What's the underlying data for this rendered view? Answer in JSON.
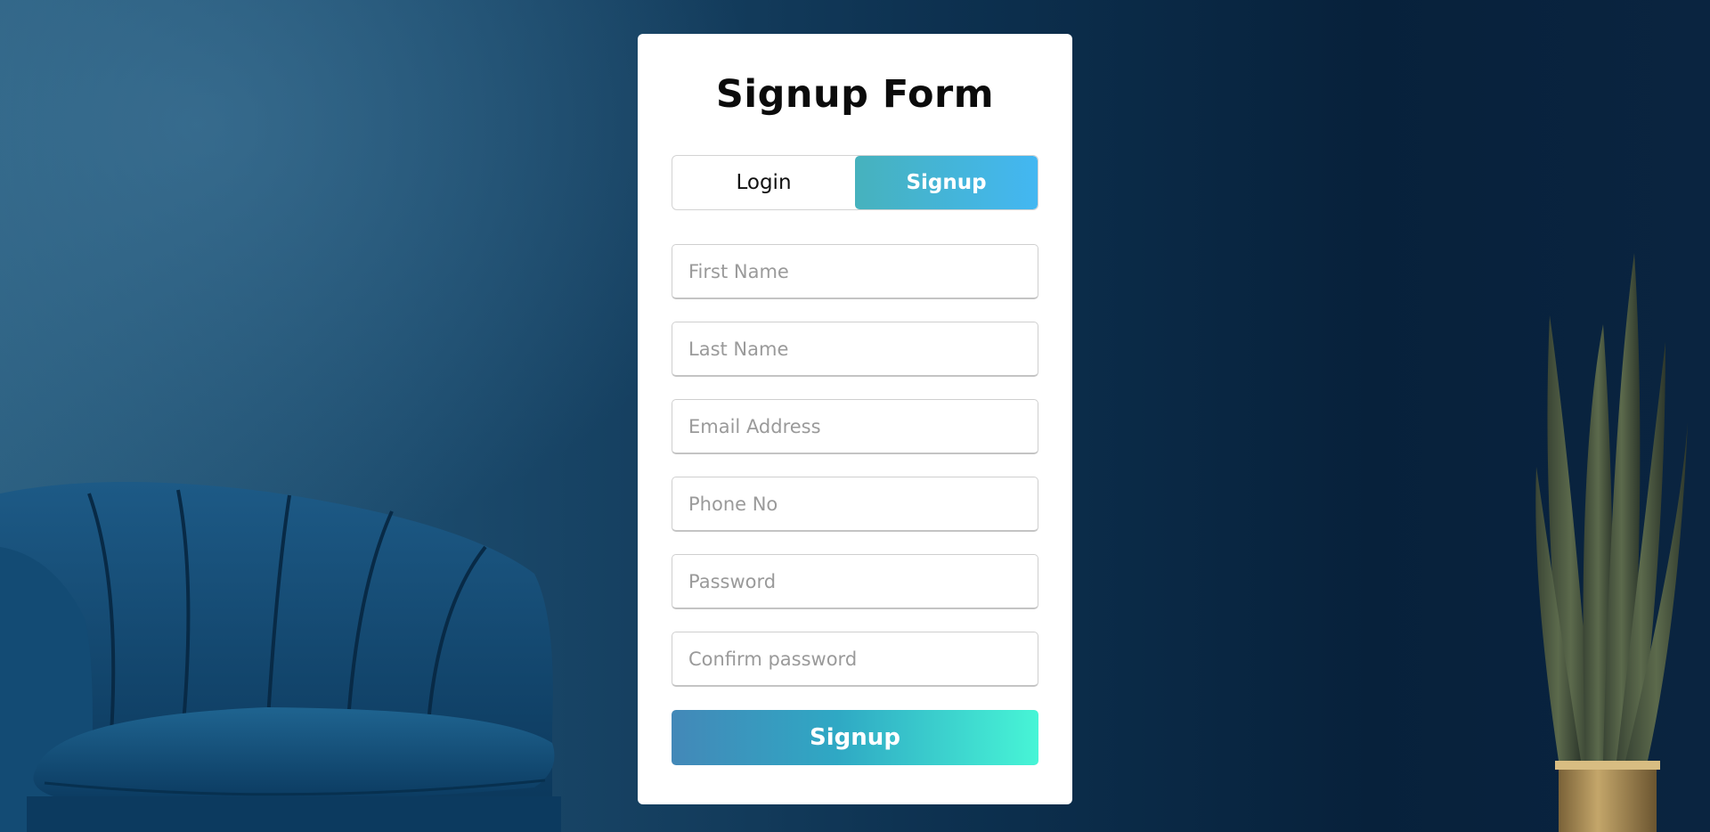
{
  "form": {
    "title": "Signup Form",
    "tabs": {
      "login_label": "Login",
      "signup_label": "Signup",
      "active": "Signup"
    },
    "fields": {
      "first_name": {
        "placeholder": "First Name",
        "value": ""
      },
      "last_name": {
        "placeholder": "Last Name",
        "value": ""
      },
      "email": {
        "placeholder": "Email Address",
        "value": ""
      },
      "phone": {
        "placeholder": "Phone No",
        "value": ""
      },
      "password": {
        "placeholder": "Password",
        "value": ""
      },
      "confirm_password": {
        "placeholder": "Confirm password",
        "value": ""
      }
    },
    "submit_label": "Signup"
  },
  "colors": {
    "tab_active_gradient": [
      "#46b2bd",
      "#43b7f2"
    ],
    "submit_gradient": [
      "#4388b8",
      "#47f5d6"
    ],
    "card_background": "#ffffff"
  },
  "background": {
    "icons": [
      "armchair-image",
      "snake-plant-image"
    ]
  }
}
